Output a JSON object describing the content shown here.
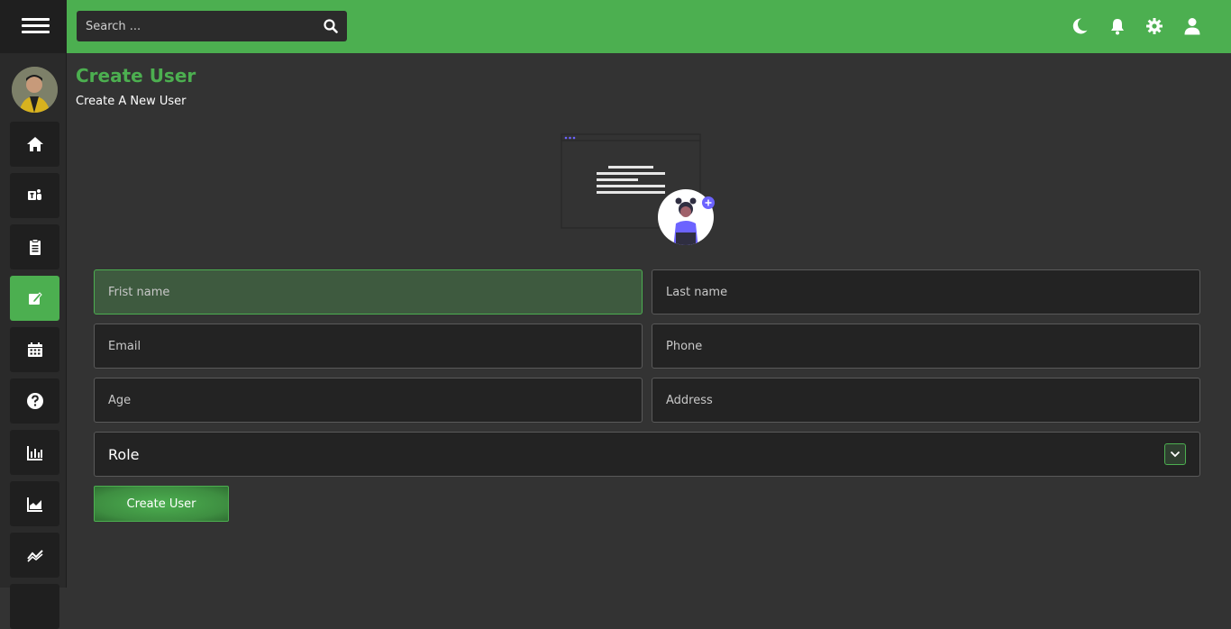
{
  "topbar": {
    "search_placeholder": "Search ...",
    "icons": [
      "search-icon",
      "moon-icon",
      "bell-icon",
      "gear-icon",
      "user-icon"
    ]
  },
  "sidebar": {
    "items": [
      {
        "icon": "home-icon"
      },
      {
        "icon": "teams-icon"
      },
      {
        "icon": "clipboard-icon"
      },
      {
        "icon": "edit-icon",
        "active": true
      },
      {
        "icon": "calendar-icon"
      },
      {
        "icon": "help-icon"
      },
      {
        "icon": "bar-chart-icon"
      },
      {
        "icon": "area-chart-icon"
      },
      {
        "icon": "line-chart-icon"
      }
    ]
  },
  "page": {
    "title": "Create User",
    "subtitle": "Create A New User"
  },
  "form": {
    "first_name_placeholder": "Frist name",
    "last_name_placeholder": "Last name",
    "email_placeholder": "Email",
    "phone_placeholder": "Phone",
    "age_placeholder": "Age",
    "address_placeholder": "Address",
    "role_label": "Role",
    "submit_label": "Create User"
  },
  "colors": {
    "accent": "#4caf50",
    "background": "#333333",
    "sidebar": "#2a2a2a",
    "field": "#232323"
  }
}
